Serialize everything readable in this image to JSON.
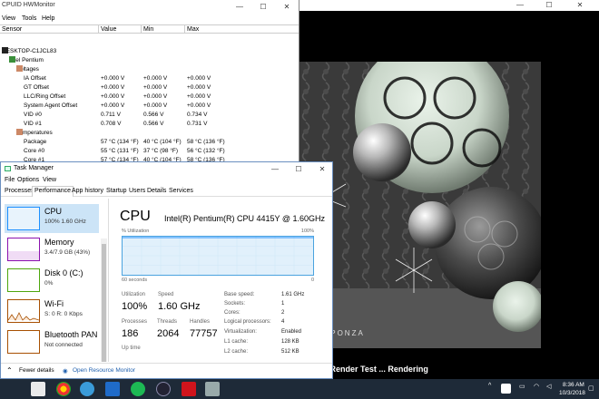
{
  "hwmonitor": {
    "title": "CPUID HWMonitor",
    "menu": [
      "View",
      "Tools",
      "Help"
    ],
    "columns": {
      "sensor": "Sensor",
      "value": "Value",
      "min": "Min",
      "max": "Max"
    },
    "rows": [
      {
        "indent": 0,
        "name": "DESKTOP-C1JCL83",
        "value": "",
        "min": "",
        "max": ""
      },
      {
        "indent": 1,
        "name": "Intel Pentium",
        "value": "",
        "min": "",
        "max": ""
      },
      {
        "indent": 2,
        "name": "Voltages",
        "value": "",
        "min": "",
        "max": ""
      },
      {
        "indent": 3,
        "name": "IA Offset",
        "value": "+0.000 V",
        "min": "+0.000 V",
        "max": "+0.000 V"
      },
      {
        "indent": 3,
        "name": "GT Offset",
        "value": "+0.000 V",
        "min": "+0.000 V",
        "max": "+0.000 V"
      },
      {
        "indent": 3,
        "name": "LLC/Ring Offset",
        "value": "+0.000 V",
        "min": "+0.000 V",
        "max": "+0.000 V"
      },
      {
        "indent": 3,
        "name": "System Agent Offset",
        "value": "+0.000 V",
        "min": "+0.000 V",
        "max": "+0.000 V"
      },
      {
        "indent": 3,
        "name": "VID #0",
        "value": "0.711 V",
        "min": "0.566 V",
        "max": "0.734 V"
      },
      {
        "indent": 3,
        "name": "VID #1",
        "value": "0.708 V",
        "min": "0.566 V",
        "max": "0.731 V"
      },
      {
        "indent": 2,
        "name": "Temperatures",
        "value": "",
        "min": "",
        "max": ""
      },
      {
        "indent": 3,
        "name": "Package",
        "value": "57 °C  (134 °F)",
        "min": "40 °C  (104 °F)",
        "max": "58 °C  (136 °F)"
      },
      {
        "indent": 3,
        "name": "Core #0",
        "value": "55 °C  (131 °F)",
        "min": "37 °C  (98 °F)",
        "max": "56 °C  (132 °F)"
      },
      {
        "indent": 3,
        "name": "Core #1",
        "value": "57 °C  (134 °F)",
        "min": "40 °C  (104 °F)",
        "max": "58 °C  (136 °F)"
      },
      {
        "indent": 2,
        "name": "Powers",
        "value": "",
        "min": "",
        "max": ""
      }
    ]
  },
  "taskmanager": {
    "title": "Task Manager",
    "menu": [
      "File",
      "Options",
      "View"
    ],
    "tabs": [
      "Processes",
      "Performance",
      "App history",
      "Startup",
      "Users",
      "Details",
      "Services"
    ],
    "active_tab": "Performance",
    "resources": [
      {
        "name": "CPU",
        "sub": "100%  1.60 GHz",
        "color": "#1e90ff"
      },
      {
        "name": "Memory",
        "sub": "3.4/7.9 GB (43%)",
        "color": "#8b12ae"
      },
      {
        "name": "Disk 0 (C:)",
        "sub": "0%",
        "color": "#4da60c"
      },
      {
        "name": "Wi-Fi",
        "sub": "S: 0  R: 0 Kbps",
        "color": "#a74f01"
      },
      {
        "name": "Bluetooth PAN",
        "sub": "Not connected",
        "color": "#a74f01"
      }
    ],
    "cpu": {
      "heading": "CPU",
      "model": "Intel(R) Pentium(R) CPU 4415Y @ 1.60GHz",
      "graph_label": "% Utilization",
      "graph_max": "100%",
      "graph_time": "60 seconds",
      "graph_zero": "0",
      "utilization_label": "Utilization",
      "utilization": "100%",
      "speed_label": "Speed",
      "speed": "1.60 GHz",
      "processes_label": "Processes",
      "processes": "186",
      "threads_label": "Threads",
      "threads": "2064",
      "handles_label": "Handles",
      "handles": "77757",
      "uptime_label": "Up time",
      "specs": [
        {
          "k": "Base speed:",
          "v": "1.61 GHz"
        },
        {
          "k": "Sockets:",
          "v": "1"
        },
        {
          "k": "Cores:",
          "v": "2"
        },
        {
          "k": "Logical processors:",
          "v": "4"
        },
        {
          "k": "Virtualization:",
          "v": "Enabled"
        },
        {
          "k": "L1 cache:",
          "v": "128 KB"
        },
        {
          "k": "L2 cache:",
          "v": "512 KB"
        }
      ]
    },
    "footer": {
      "fewer": "Fewer details",
      "open_rm": "Open Resource Monitor"
    }
  },
  "render": {
    "watermark": "AIXSPONZA",
    "status": "rming Render Test ... Rendering"
  },
  "taskbar": {
    "time": "8:36 AM",
    "date": "10/3/2018"
  }
}
